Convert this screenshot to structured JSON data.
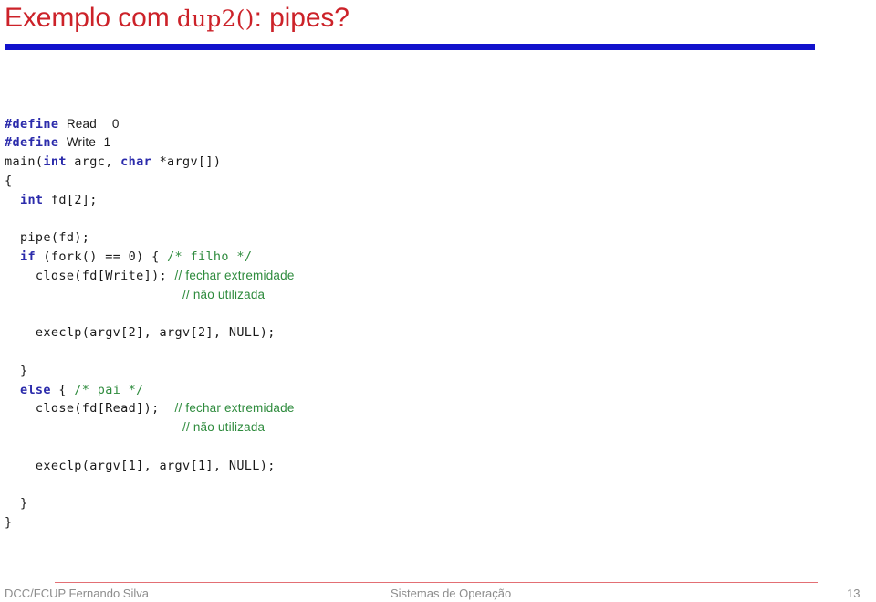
{
  "slide": {
    "title_prefix": "Exemplo com ",
    "title_mono": "dup2()",
    "title_suffix": ": pipes?",
    "title_color": "#cc2229",
    "rule_color": "#1111cc",
    "background": "#ffffff"
  },
  "code": {
    "language": "C",
    "keyword_color": "#2b2bab",
    "comment_color": "#2e8b3d",
    "text_color": "#1a1a1a",
    "lines": [
      {
        "indent": 0,
        "tokens": [
          {
            "t": "#define",
            "c": "kw"
          },
          {
            "t": " ",
            "c": "id"
          },
          {
            "t": "Read",
            "c": "sans"
          },
          {
            "t": "  ",
            "c": "id"
          },
          {
            "t": "0",
            "c": "sans"
          }
        ]
      },
      {
        "indent": 0,
        "tokens": [
          {
            "t": "#define",
            "c": "kw"
          },
          {
            "t": " ",
            "c": "id"
          },
          {
            "t": "Write",
            "c": "sans"
          },
          {
            "t": " ",
            "c": "id"
          },
          {
            "t": "1",
            "c": "sans"
          }
        ]
      },
      {
        "indent": 0,
        "tokens": [
          {
            "t": "main(",
            "c": "id"
          },
          {
            "t": "int",
            "c": "kw"
          },
          {
            "t": " argc, ",
            "c": "id"
          },
          {
            "t": "char",
            "c": "kw"
          },
          {
            "t": " *argv[])",
            "c": "id"
          }
        ]
      },
      {
        "indent": 0,
        "tokens": [
          {
            "t": "{",
            "c": "id"
          }
        ]
      },
      {
        "indent": 0,
        "tokens": [
          {
            "t": "  ",
            "c": "id"
          },
          {
            "t": "int",
            "c": "kw"
          },
          {
            "t": " fd[2];",
            "c": "id"
          }
        ]
      },
      {
        "indent": 0,
        "tokens": [
          {
            "t": "",
            "c": "id"
          }
        ]
      },
      {
        "indent": 0,
        "tokens": [
          {
            "t": "  pipe(fd);",
            "c": "id"
          }
        ]
      },
      {
        "indent": 0,
        "tokens": [
          {
            "t": "  ",
            "c": "id"
          },
          {
            "t": "if",
            "c": "kw"
          },
          {
            "t": " (fork() == 0) { ",
            "c": "id"
          },
          {
            "t": "/* filho */",
            "c": "cm"
          }
        ]
      },
      {
        "indent": 0,
        "tokens": [
          {
            "t": "    close(fd[Write]); ",
            "c": "id"
          },
          {
            "t": "// fechar extremidade",
            "c": "cm sans"
          }
        ]
      },
      {
        "indent": 0,
        "tokens": [
          {
            "t": "                       ",
            "c": "id"
          },
          {
            "t": "// não utilizada",
            "c": "cm sans"
          }
        ]
      },
      {
        "indent": 0,
        "tokens": [
          {
            "t": "",
            "c": "id"
          }
        ]
      },
      {
        "indent": 0,
        "tokens": [
          {
            "t": "    execlp(argv[2], argv[2], NULL);",
            "c": "id"
          }
        ]
      },
      {
        "indent": 0,
        "tokens": [
          {
            "t": "",
            "c": "id"
          }
        ]
      },
      {
        "indent": 0,
        "tokens": [
          {
            "t": "  }",
            "c": "id"
          }
        ]
      },
      {
        "indent": 0,
        "tokens": [
          {
            "t": "  ",
            "c": "id"
          },
          {
            "t": "else",
            "c": "kw"
          },
          {
            "t": " { ",
            "c": "id"
          },
          {
            "t": "/* pai */",
            "c": "cm"
          }
        ]
      },
      {
        "indent": 0,
        "tokens": [
          {
            "t": "    close(fd[Read]);  ",
            "c": "id"
          },
          {
            "t": "// fechar extremidade",
            "c": "cm sans"
          }
        ]
      },
      {
        "indent": 0,
        "tokens": [
          {
            "t": "                       ",
            "c": "id"
          },
          {
            "t": "// não utilizada",
            "c": "cm sans"
          }
        ]
      },
      {
        "indent": 0,
        "tokens": [
          {
            "t": "",
            "c": "id"
          }
        ]
      },
      {
        "indent": 0,
        "tokens": [
          {
            "t": "    execlp(argv[1], argv[1], NULL);",
            "c": "id"
          }
        ]
      },
      {
        "indent": 0,
        "tokens": [
          {
            "t": "",
            "c": "id"
          }
        ]
      },
      {
        "indent": 0,
        "tokens": [
          {
            "t": "  }",
            "c": "id"
          }
        ]
      },
      {
        "indent": 0,
        "tokens": [
          {
            "t": "}",
            "c": "id"
          }
        ]
      }
    ]
  },
  "footer": {
    "left": "DCC/FCUP Fernando Silva",
    "center": "Sistemas de Operação",
    "page_number": "13",
    "text_color": "#8d8d8d",
    "rule_color": "#e36f74"
  }
}
